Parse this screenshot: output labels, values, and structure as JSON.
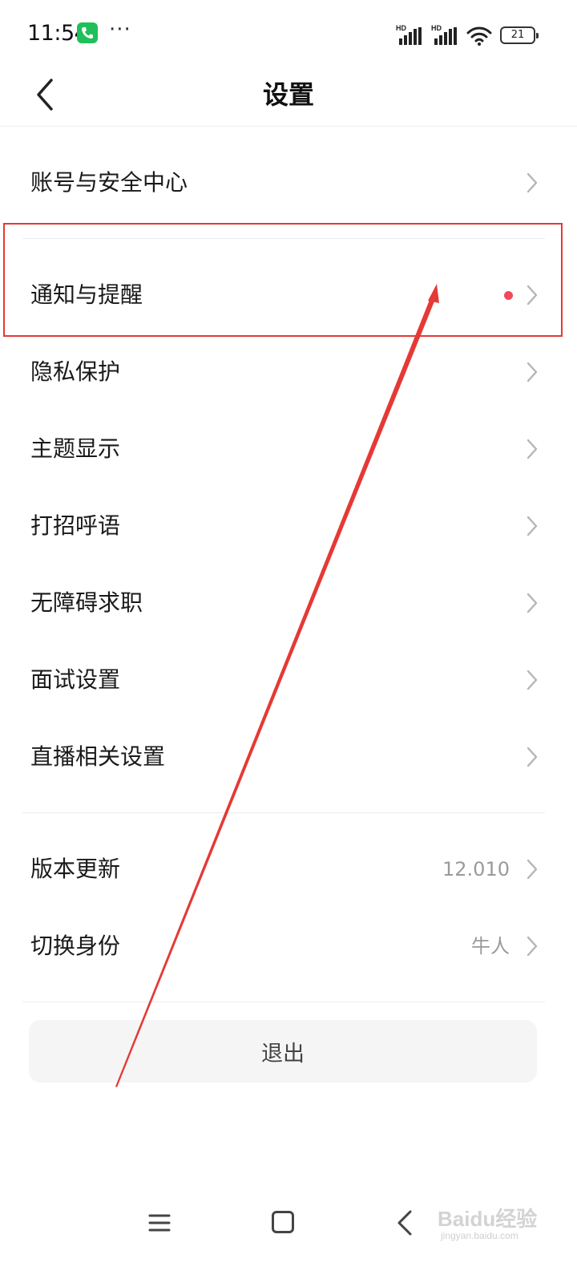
{
  "status_bar": {
    "time": "11:54",
    "more_glyph": "···",
    "hd_label": "HD",
    "battery_level": "21",
    "call_icon_color": "#1fbf5a"
  },
  "header": {
    "title": "设置",
    "back_icon": "chevron-left-icon"
  },
  "settings": {
    "items": [
      {
        "label": "账号与安全中心"
      },
      {
        "label": "通知与提醒",
        "has_red_dot": true
      },
      {
        "label": "隐私保护"
      },
      {
        "label": "主题显示"
      },
      {
        "label": "打招呼语"
      },
      {
        "label": "无障碍求职"
      },
      {
        "label": "面试设置"
      },
      {
        "label": "直播相关设置"
      },
      {
        "label": "版本更新",
        "value": "12.010"
      },
      {
        "label": "切换身份",
        "value": "牛人"
      }
    ]
  },
  "logout": {
    "label": "退出"
  },
  "annotation": {
    "color": "#e53935"
  },
  "colors": {
    "red_dot": "#f2495c",
    "secondary_text": "#9a9a9a",
    "logout_bg": "#f5f5f5"
  },
  "nav_bar": {
    "icons": [
      "menu-icon",
      "home-icon",
      "back-icon"
    ]
  },
  "watermark": {
    "main": "Baidu经验",
    "sub": "jingyan.baidu.com"
  }
}
